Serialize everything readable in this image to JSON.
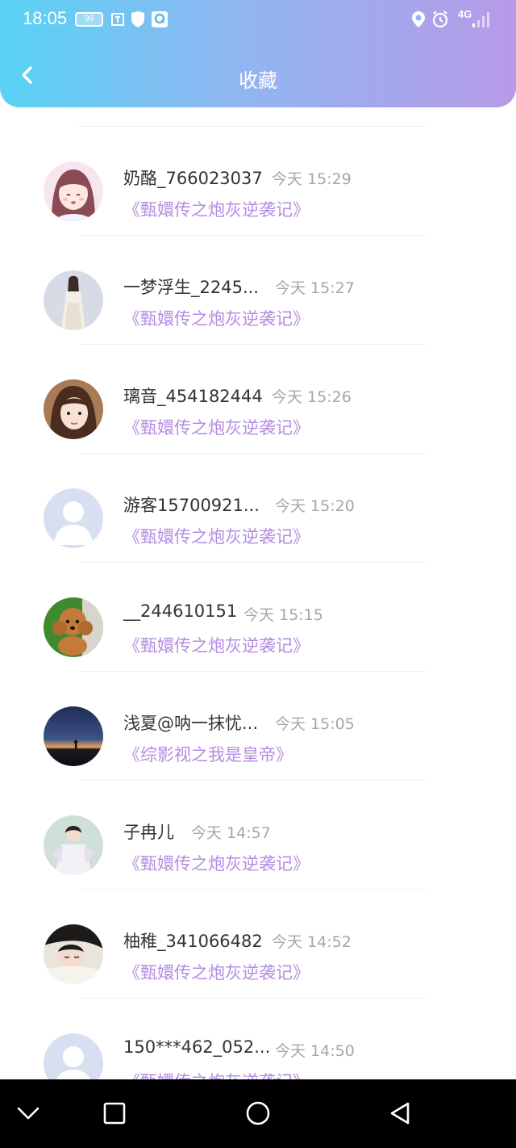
{
  "status_bar": {
    "time": "18:05",
    "battery": "99",
    "network": "4G"
  },
  "header": {
    "title": "收藏"
  },
  "favorites": [
    {
      "name": "奶酪_766023037",
      "time": "今天 15:29",
      "book": "《甄嬛传之炮灰逆袭记》",
      "avatar": "anime-girl-avatar"
    },
    {
      "name": "一梦浮生_2245...",
      "time": "今天 15:27",
      "book": "《甄嬛传之炮灰逆袭记》",
      "avatar": "white-dress-woman-avatar"
    },
    {
      "name": "璃音_454182444",
      "time": "今天 15:26",
      "book": "《甄嬛传之炮灰逆袭记》",
      "avatar": "girl-portrait-avatar"
    },
    {
      "name": "游客15700921...",
      "time": "今天 15:20",
      "book": "《甄嬛传之炮灰逆袭记》",
      "avatar": "default-user-avatar"
    },
    {
      "name": "__244610151",
      "time": "今天 15:15",
      "book": "《甄嬛传之炮灰逆袭记》",
      "avatar": "poodle-dog-avatar"
    },
    {
      "name": "浅夏@呐一抹忧...",
      "time": "今天 15:05",
      "book": "《综影视之我是皇帝》",
      "avatar": "sunset-silhouette-avatar"
    },
    {
      "name": "子冉儿",
      "time": "今天 14:57",
      "book": "《甄嬛传之炮灰逆袭记》",
      "avatar": "hanfu-woman-avatar"
    },
    {
      "name": "柚稚_341066482",
      "time": "今天 14:52",
      "book": "《甄嬛传之炮灰逆袭记》",
      "avatar": "sleeping-girl-avatar"
    },
    {
      "name": "150***462_052...",
      "time": "今天 14:50",
      "book": "《甄嬛传之炮灰逆袭记》",
      "avatar": "default-user-avatar"
    }
  ],
  "colors": {
    "header_start": "#58d3f5",
    "header_end": "#b79ae8",
    "book_title": "#b48ce2",
    "timestamp": "#a6a6a6"
  }
}
